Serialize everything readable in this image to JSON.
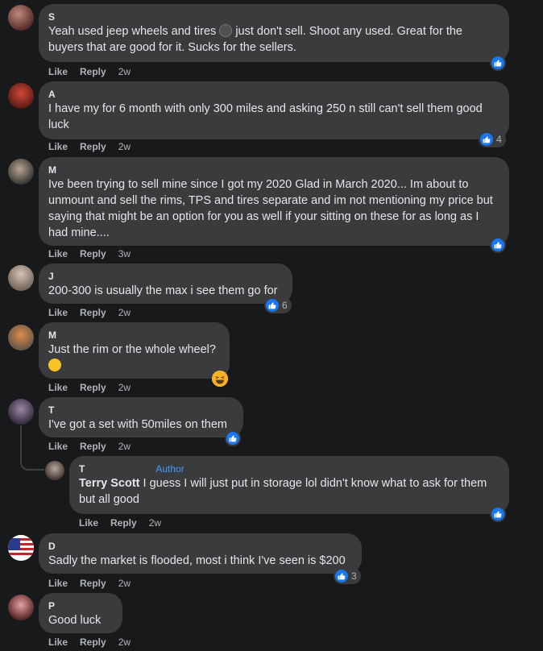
{
  "colors": {
    "background": "#18191a",
    "bubble": "#3a3b3c",
    "like_blue": "#1877f2",
    "author_badge": "#4599ff",
    "meta_text": "#b0b3b8"
  },
  "actions": {
    "like": "Like",
    "reply": "Reply"
  },
  "comments": [
    {
      "author": "S",
      "text": "Yeah used jeep wheels and tires",
      "text2": " just don't sell. Shoot any used. Great for the buyers that are good for it. Sucks for the sellers.",
      "time": "2w",
      "reactions": "",
      "inline_icon": "sticker-icon"
    },
    {
      "author": "A",
      "text": "I have my for 6 month with only 300 miles and asking 250 n still can't sell them good luck",
      "time": "2w",
      "reactions": "4"
    },
    {
      "author": "M",
      "text": "Ive been trying to sell mine since I got my 2020 Glad in March 2020... Im about to unmount and sell the rims, TPS and tires separate and im not mentioning my price but saying that might be an option for you as well if your sitting on these for as long as I had mine....",
      "time": "3w",
      "reactions": ""
    },
    {
      "author": "J",
      "text": "200-300 is usually the max i see them go for",
      "time": "2w",
      "reactions": "6"
    },
    {
      "author": "M",
      "text": "Just the rim or the whole wheel?",
      "time": "2w",
      "reactions": "",
      "emoji": "rolling-laugh-emoji",
      "reaction_icon": "haha-icon"
    },
    {
      "author": "T",
      "text": "I've got a set with 50miles on them",
      "time": "2w",
      "reactions": ""
    },
    {
      "author": "T",
      "badge": "Author",
      "name_inline": "Terry Scott",
      "text": " I guess I will just put in storage lol didn't know what to ask for them but all good",
      "time": "2w",
      "reactions": ""
    },
    {
      "author": "D",
      "text": "Sadly the market is flooded, most i think I've seen is $200",
      "time": "2w",
      "reactions": "3"
    },
    {
      "author": "P",
      "text": "Good luck",
      "time": "2w",
      "reactions": ""
    }
  ]
}
